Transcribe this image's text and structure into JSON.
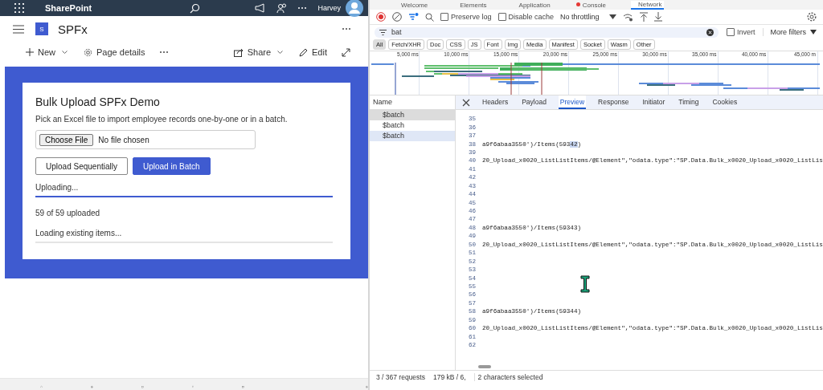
{
  "sharepoint": {
    "app_name": "SharePoint",
    "user_name": "Harvey",
    "site_logo_letter": "S",
    "site_title": "SPFx",
    "left_commands": [
      {
        "kind": "plus",
        "label": "New",
        "dropdown": true
      },
      {
        "kind": "gear",
        "label": "Page details",
        "dropdown": false
      }
    ],
    "right_commands": [
      {
        "kind": "share",
        "label": "Share",
        "dropdown": true
      },
      {
        "kind": "pencil",
        "label": "Edit",
        "dropdown": false
      }
    ]
  },
  "webpart": {
    "title": "Bulk Upload SPFx Demo",
    "description": "Pick an Excel file to import employee records one-by-one or in a batch.",
    "file_button": "Choose File",
    "file_status": "No file chosen",
    "buttons": [
      {
        "label": "Upload Sequentially",
        "primary": false
      },
      {
        "label": "Upload in Batch",
        "primary": true
      }
    ],
    "status": [
      {
        "kind": "progress",
        "label": "Uploading...",
        "level": 1
      },
      {
        "kind": "text",
        "label": "59 of 59 uploaded"
      },
      {
        "kind": "progress",
        "label": "Loading existing items...",
        "level": 0
      }
    ]
  },
  "devtools": {
    "tabs": [
      {
        "label": "Welcome",
        "selected": false,
        "error_badge": false
      },
      {
        "label": "Elements",
        "selected": false,
        "error_badge": false
      },
      {
        "label": "Application",
        "selected": false,
        "error_badge": false
      },
      {
        "label": "Console",
        "selected": false,
        "error_badge": true
      },
      {
        "label": "Network",
        "selected": true,
        "error_badge": false
      }
    ],
    "preserve_log": {
      "label": "Preserve log",
      "checked": false
    },
    "disable_cache": {
      "label": "Disable cache",
      "checked": false
    },
    "throttling": "No throttling",
    "filter": {
      "value": "bat",
      "invert": {
        "label": "Invert",
        "checked": false
      },
      "more_filters": "More filters"
    },
    "type_filters": [
      {
        "label": "All",
        "selected": true
      },
      {
        "label": "Fetch/XHR",
        "selected": false
      },
      {
        "label": "Doc",
        "selected": false
      },
      {
        "label": "CSS",
        "selected": false
      },
      {
        "label": "JS",
        "selected": false
      },
      {
        "label": "Font",
        "selected": false
      },
      {
        "label": "Img",
        "selected": false
      },
      {
        "label": "Media",
        "selected": false
      },
      {
        "label": "Manifest",
        "selected": false
      },
      {
        "label": "Socket",
        "selected": false
      },
      {
        "label": "Wasm",
        "selected": false
      },
      {
        "label": "Other",
        "selected": false
      }
    ],
    "timeline": {
      "tick_labels": [
        "5,000 ms",
        "10,000 ms",
        "15,000 ms",
        "20,000 ms",
        "25,000 ms",
        "30,000 ms",
        "35,000 ms",
        "40,000 ms",
        "45,000 m"
      ]
    },
    "requests": {
      "header": "Name",
      "items": [
        {
          "name": "$batch",
          "selected": true,
          "hovered": false
        },
        {
          "name": "$batch",
          "selected": false,
          "hovered": false
        },
        {
          "name": "$batch",
          "selected": false,
          "hovered": true
        }
      ]
    },
    "detail_tabs": [
      {
        "label": "Headers",
        "selected": false
      },
      {
        "label": "Payload",
        "selected": false
      },
      {
        "label": "Preview",
        "selected": true
      },
      {
        "label": "Response",
        "selected": false
      },
      {
        "label": "Initiator",
        "selected": false
      },
      {
        "label": "Timing",
        "selected": false
      },
      {
        "label": "Cookies",
        "selected": false
      }
    ],
    "code_lines": [
      {
        "number": "35"
      },
      {
        "number": "36"
      },
      {
        "number": "37"
      },
      {
        "number": "38",
        "parts": [
          {
            "text": "a9f6abaa3550')/Items(593",
            "selected": false
          },
          {
            "text": "42",
            "selected": true
          },
          {
            "text": ")",
            "selected": false
          }
        ]
      },
      {
        "number": "39"
      },
      {
        "number": "40",
        "parts": [
          {
            "text": "20_Upload_x0020_ListListItems/@Element\",\"odata.type\":\"SP.Data.Bulk_x0020_Upload_x0020_ListLis",
            "selected": false
          }
        ]
      },
      {
        "number": "41"
      },
      {
        "number": "42"
      },
      {
        "number": "43"
      },
      {
        "number": "44"
      },
      {
        "number": "45"
      },
      {
        "number": "46"
      },
      {
        "number": "47"
      },
      {
        "number": "48",
        "parts": [
          {
            "text": "a9f6abaa3550')/Items(59343)",
            "selected": false
          }
        ]
      },
      {
        "number": "49"
      },
      {
        "number": "50",
        "parts": [
          {
            "text": "20_Upload_x0020_ListListItems/@Element\",\"odata.type\":\"SP.Data.Bulk_x0020_Upload_x0020_ListLis",
            "selected": false
          }
        ]
      },
      {
        "number": "51"
      },
      {
        "number": "52"
      },
      {
        "number": "53"
      },
      {
        "number": "54"
      },
      {
        "number": "55"
      },
      {
        "number": "56"
      },
      {
        "number": "57"
      },
      {
        "number": "58",
        "parts": [
          {
            "text": "a9f6abaa3550')/Items(59344)",
            "selected": false
          }
        ]
      },
      {
        "number": "59"
      },
      {
        "number": "60",
        "parts": [
          {
            "text": "20_Upload_x0020_ListListItems/@Element\",\"odata.type\":\"SP.Data.Bulk_x0020_Upload_x0020_ListLis",
            "selected": false
          }
        ]
      },
      {
        "number": "61"
      },
      {
        "number": "62"
      }
    ],
    "status_bar": {
      "requests": "3 / 367 requests",
      "transferred": "179 kB / 6,",
      "selection": "2 characters selected"
    }
  }
}
